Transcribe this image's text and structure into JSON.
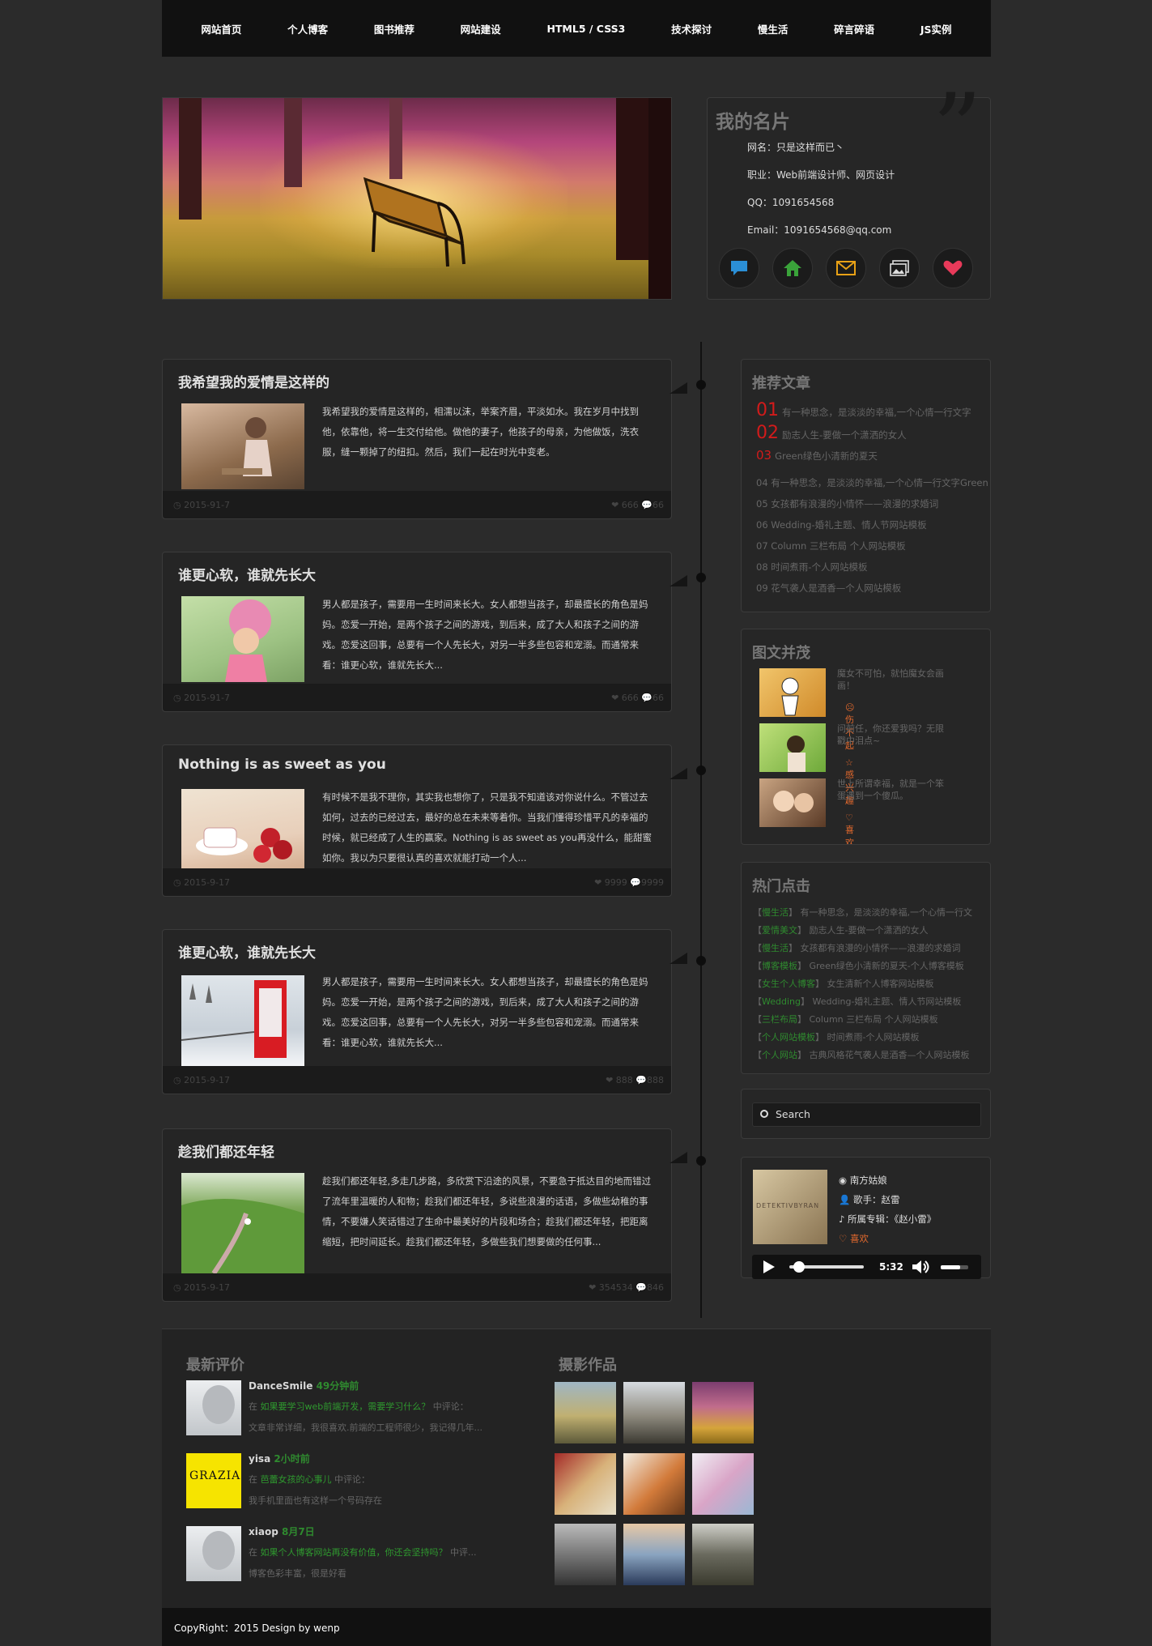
{
  "nav": [
    "网站首页",
    "个人博客",
    "图书推荐",
    "网站建设",
    "HTML5 / CSS3",
    "技术探讨",
    "慢生活",
    "碎言碎语",
    "JS实例"
  ],
  "card": {
    "title": "我的名片",
    "rows": [
      "网名：只是这样而已丶",
      "职业：Web前端设计师、网页设计",
      "QQ：1091654568",
      "Email：1091654568@qq.com"
    ],
    "icons": [
      "chat-icon",
      "home-icon",
      "mail-icon",
      "gallery-icon",
      "heart-icon"
    ],
    "icon_colors": [
      "#2b8fd6",
      "#3aa33a",
      "#e8a116",
      "#e0e0e0",
      "#e83a5a"
    ]
  },
  "posts": [
    {
      "title": "我希望我的爱情是这样的",
      "text": "我希望我的爱情是这样的，相濡以沫，举案齐眉，平淡如水。我在岁月中找到他，依靠他，将一生交付给他。做他的妻子，他孩子的母亲，为他做饭，洗衣服，缝一颗掉了的纽扣。然后，我们一起在时光中变老。",
      "date": "2015-91-7",
      "likes": "666",
      "comments": "66"
    },
    {
      "title": "谁更心软，谁就先长大",
      "text": "男人都是孩子，需要用一生时间来长大。女人都想当孩子，却最擅长的角色是妈妈。恋爱一开始，是两个孩子之间的游戏，到后来，成了大人和孩子之间的游戏。恋爱这回事，总要有一个人先长大，对另一半多些包容和宠溺。而通常来看：谁更心软，谁就先长大...",
      "date": "2015-91-7",
      "likes": "666",
      "comments": "66"
    },
    {
      "title": "Nothing is as sweet as you",
      "text": "有时候不是我不理你，其实我也想你了，只是我不知道该对你说什么。不管过去如何，过去的已经过去，最好的总在未来等着你。当我们懂得珍惜平凡的幸福的时候，就已经成了人生的赢家。Nothing is as sweet as you再没什么，能甜蜜如你。我以为只要很认真的喜欢就能打动一个人...",
      "date": "2015-9-17",
      "likes": "9999",
      "comments": "9999"
    },
    {
      "title": "谁更心软，谁就先长大",
      "text": "男人都是孩子，需要用一生时间来长大。女人都想当孩子，却最擅长的角色是妈妈。恋爱一开始，是两个孩子之间的游戏，到后来，成了大人和孩子之间的游戏。恋爱这回事，总要有一个人先长大，对另一半多些包容和宠溺。而通常来看：谁更心软，谁就先长大...",
      "date": "2015-9-17",
      "likes": "888",
      "comments": "888"
    },
    {
      "title": "趁我们都还年轻",
      "text": "趁我们都还年轻,多走几步路，多欣赏下沿途的风景，不要急于抵达目的地而错过了流年里温暖的人和物；趁我们都还年轻，多说些浪漫的话语，多做些幼稚的事情，不要嫌人笑话错过了生命中最美好的片段和场合；趁我们都还年轻，把距离缩短，把时间延长。趁我们都还年轻，多做些我们想要做的任何事...",
      "date": "2015-9-17",
      "likes": "354534",
      "comments": "846"
    }
  ],
  "recommend": {
    "title": "推荐文章",
    "items": [
      {
        "num": "01",
        "text": "有一种思念，是淡淡的幸福,一个心情一行文字"
      },
      {
        "num": "02",
        "text": "励志人生-要做一个潇洒的女人"
      },
      {
        "num": "03",
        "text": "Green绿色小清新的夏天"
      },
      {
        "num": "04",
        "text": "有一种思念，是淡淡的幸福,一个心情一行文字Green"
      },
      {
        "num": "05",
        "text": "女孩都有浪漫的小情怀——浪漫的求婚词"
      },
      {
        "num": "06",
        "text": "Wedding-婚礼主题、情人节网站模板"
      },
      {
        "num": "07",
        "text": "Column 三栏布局 个人网站模板"
      },
      {
        "num": "08",
        "text": "时间煮雨-个人网站模板"
      },
      {
        "num": "09",
        "text": "花气袭人是酒香—个人网站模板"
      }
    ]
  },
  "tuwen": {
    "title": "图文并茂",
    "items": [
      {
        "text": "魔女不可怕，就怕魔女会画画！",
        "tag": "伤不起",
        "tag_icon": "sad-icon"
      },
      {
        "text": "问前任，你还爱我吗？无限戳中泪点~",
        "tag": "感兴趣",
        "tag_icon": "star-icon"
      },
      {
        "text": "世上所谓幸福，就是一个笨蛋遇到一个傻瓜。",
        "tag": "喜欢",
        "tag_icon": "heart-icon"
      }
    ]
  },
  "hot": {
    "title": "热门点击",
    "items": [
      {
        "cat": "慢生活",
        "text": "有一种思念，是淡淡的幸福,一个心情一行文"
      },
      {
        "cat": "爱情美文",
        "text": "励志人生-要做一个潇洒的女人"
      },
      {
        "cat": "慢生活",
        "text": "女孩都有浪漫的小情怀——浪漫的求婚词"
      },
      {
        "cat": "博客模板",
        "text": "Green绿色小清新的夏天-个人博客模板"
      },
      {
        "cat": "女生个人博客",
        "text": "女生清新个人博客网站模板"
      },
      {
        "cat": "Wedding",
        "text": "Wedding-婚礼主题、情人节网站模板"
      },
      {
        "cat": "三栏布局",
        "text": "Column 三栏布局 个人网站模板"
      },
      {
        "cat": "个人网站模板",
        "text": "时间煮雨-个人网站模板"
      },
      {
        "cat": "个人网站",
        "text": "古典风格花气袭人是酒香—个人网站模板"
      }
    ]
  },
  "search": {
    "placeholder": "Search"
  },
  "player": {
    "song": "南方姑娘",
    "singer": "歌手：赵雷",
    "album": "所属专辑：《赵小雷》",
    "like": "喜欢",
    "time": "5:32",
    "cover_text": "DETEKTIVBYRAN",
    "progress": 0.05,
    "volume": 0.7
  },
  "comments": {
    "title": "最新评价",
    "items": [
      {
        "user": "DanceSmile",
        "time": "49分钟前",
        "prefix": "在",
        "link": "如果要学习web前端开发，需要学习什么？",
        "suffix": "中评论：",
        "body": "文章非常详细，我很喜欢.前端的工程师很少，我记得几年..."
      },
      {
        "user": "yisa",
        "time": "2小时前",
        "prefix": "在",
        "link": "芭蕾女孩的心事儿",
        "suffix": "中评论：",
        "body": "我手机里面也有这样一个号码存在",
        "avatar_text": "GRAZIA"
      },
      {
        "user": "xiaop",
        "time": "8月7日",
        "prefix": "在",
        "link": "如果个人博客网站再没有价值，你还会坚持吗？",
        "suffix": "中评...",
        "body": "博客色彩丰富，很是好看"
      }
    ]
  },
  "photos": {
    "title": "摄影作品"
  },
  "copyright": "CopyRight：2015 Design by wenp"
}
